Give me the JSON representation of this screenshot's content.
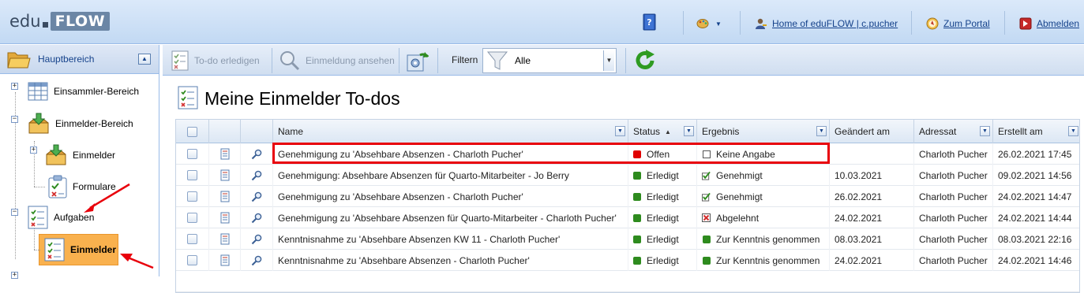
{
  "app": {
    "logo_left": "edu",
    "logo_right": "FLOW"
  },
  "top_links": {
    "help_icon": "help-book-icon",
    "theme_icon": "palette-icon",
    "home_label": "Home of eduFLOW | c.pucher",
    "portal_label": "Zum Portal",
    "logout_label": "Abmelden"
  },
  "sidebar": {
    "title": "Hauptbereich",
    "items": [
      {
        "label": "Einsammler-Bereich",
        "icon": "table-icon"
      },
      {
        "label": "Einmelder-Bereich",
        "icon": "inbox-icon"
      },
      {
        "label": "Einmelder",
        "icon": "inbox-icon"
      },
      {
        "label": "Formulare",
        "icon": "clipboard-icon"
      },
      {
        "label": "Aufgaben",
        "icon": "todo-list-icon"
      },
      {
        "label": "Einmelder",
        "icon": "todo-list-icon"
      }
    ]
  },
  "toolbar": {
    "todo_done": "To-do erledigen",
    "view_report": "Einmeldung ansehen",
    "filter_label": "Filtern",
    "filter_value": "Alle"
  },
  "page": {
    "title": "Meine Einmelder To-dos"
  },
  "grid": {
    "columns": {
      "name": "Name",
      "status": "Status",
      "ergebnis": "Ergebnis",
      "geaendert": "Geändert am",
      "adressat": "Adressat",
      "erstellt": "Erstellt am"
    },
    "rows": [
      {
        "name": "Genehmigung zu 'Absehbare Absenzen - Charloth Pucher'",
        "status": "Offen",
        "status_color": "#e00000",
        "ergebnis": "Keine Angabe",
        "ergebnis_kind": "none",
        "geaendert": "",
        "adressat": "Charloth Pucher",
        "erstellt": "26.02.2021 17:45"
      },
      {
        "name": "Genehmigung: Absehbare Absenzen für Quarto-Mitarbeiter - Jo Berry",
        "status": "Erledigt",
        "status_color": "#2e8b1e",
        "ergebnis": "Genehmigt",
        "ergebnis_kind": "check",
        "geaendert": "10.03.2021",
        "adressat": "Charloth Pucher",
        "erstellt": "09.02.2021 14:56"
      },
      {
        "name": "Genehmigung zu 'Absehbare Absenzen - Charloth Pucher'",
        "status": "Erledigt",
        "status_color": "#2e8b1e",
        "ergebnis": "Genehmigt",
        "ergebnis_kind": "check",
        "geaendert": "26.02.2021",
        "adressat": "Charloth Pucher",
        "erstellt": "24.02.2021 14:47"
      },
      {
        "name": "Genehmigung zu 'Absehbare Absenzen für Quarto-Mitarbeiter - Charloth Pucher'",
        "status": "Erledigt",
        "status_color": "#2e8b1e",
        "ergebnis": "Abgelehnt",
        "ergebnis_kind": "cross",
        "geaendert": "24.02.2021",
        "adressat": "Charloth Pucher",
        "erstellt": "24.02.2021 14:44"
      },
      {
        "name": "Kenntnisnahme zu 'Absehbare Absenzen KW 11 - Charloth Pucher'",
        "status": "Erledigt",
        "status_color": "#2e8b1e",
        "ergebnis": "Zur Kenntnis genommen",
        "ergebnis_kind": "green",
        "geaendert": "08.03.2021",
        "adressat": "Charloth Pucher",
        "erstellt": "08.03.2021 22:16"
      },
      {
        "name": "Kenntnisnahme zu 'Absehbare Absenzen - Charloth Pucher'",
        "status": "Erledigt",
        "status_color": "#2e8b1e",
        "ergebnis": "Zur Kenntnis genommen",
        "ergebnis_kind": "green",
        "geaendert": "24.02.2021",
        "adressat": "Charloth Pucher",
        "erstellt": "24.02.2021 14:46"
      }
    ]
  },
  "colors": {
    "highlight": "#e8000b",
    "selected_node": "#f9b14e",
    "header_blue": "#15428b"
  }
}
